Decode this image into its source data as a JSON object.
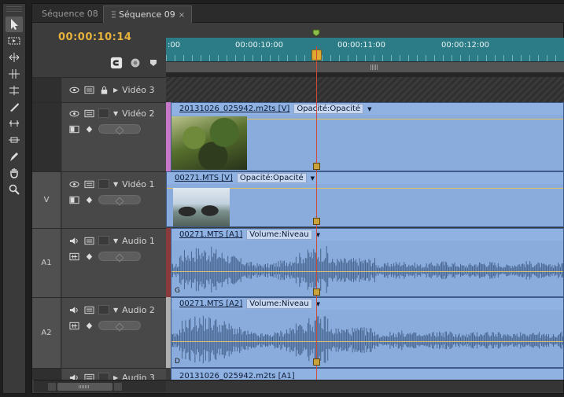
{
  "tabs": [
    {
      "label": "Séquence 08",
      "active": false
    },
    {
      "label": "Séquence 09",
      "active": true,
      "close": "×"
    }
  ],
  "timecode": "00:00:10:14",
  "ruler": {
    "labels": [
      ":00",
      "00:00:10:00",
      "00:00:11:00",
      "00:00:12:00"
    ],
    "zoom_handle": "III"
  },
  "tools": [
    "selection-tool",
    "track-select-tool",
    "ripple-edit-tool",
    "rolling-edit-tool",
    "rate-stretch-tool",
    "razor-tool",
    "slip-tool",
    "slide-tool",
    "pen-tool",
    "hand-tool",
    "zoom-tool"
  ],
  "tracks": {
    "video3": {
      "name": "Vidéo 3"
    },
    "video2": {
      "name": "Vidéo 2",
      "clip_name": "20131026_025942.m2ts [V]",
      "clip_fx": "Opacité:Opacité"
    },
    "video1": {
      "label": "V",
      "name": "Vidéo 1",
      "clip_name": "00271.MTS [V]",
      "clip_fx": "Opacité:Opacité"
    },
    "audio1": {
      "label": "A1",
      "name": "Audio 1",
      "clip_name": "00271.MTS [A1]",
      "clip_fx": "Volume:Niveau",
      "channel": "G"
    },
    "audio2": {
      "label": "A2",
      "name": "Audio 2",
      "clip_name": "00271.MTS [A2]",
      "clip_fx": "Volume:Niveau",
      "channel": "D"
    },
    "audio3": {
      "name": "Audio 3",
      "clip_name": "20131026_025942.m2ts [A1]"
    }
  },
  "colors": {
    "timecode": "#e6b23c",
    "ruler": "#2b7c86",
    "clip": "#7ba2d8",
    "playhead": "#d24b38"
  }
}
